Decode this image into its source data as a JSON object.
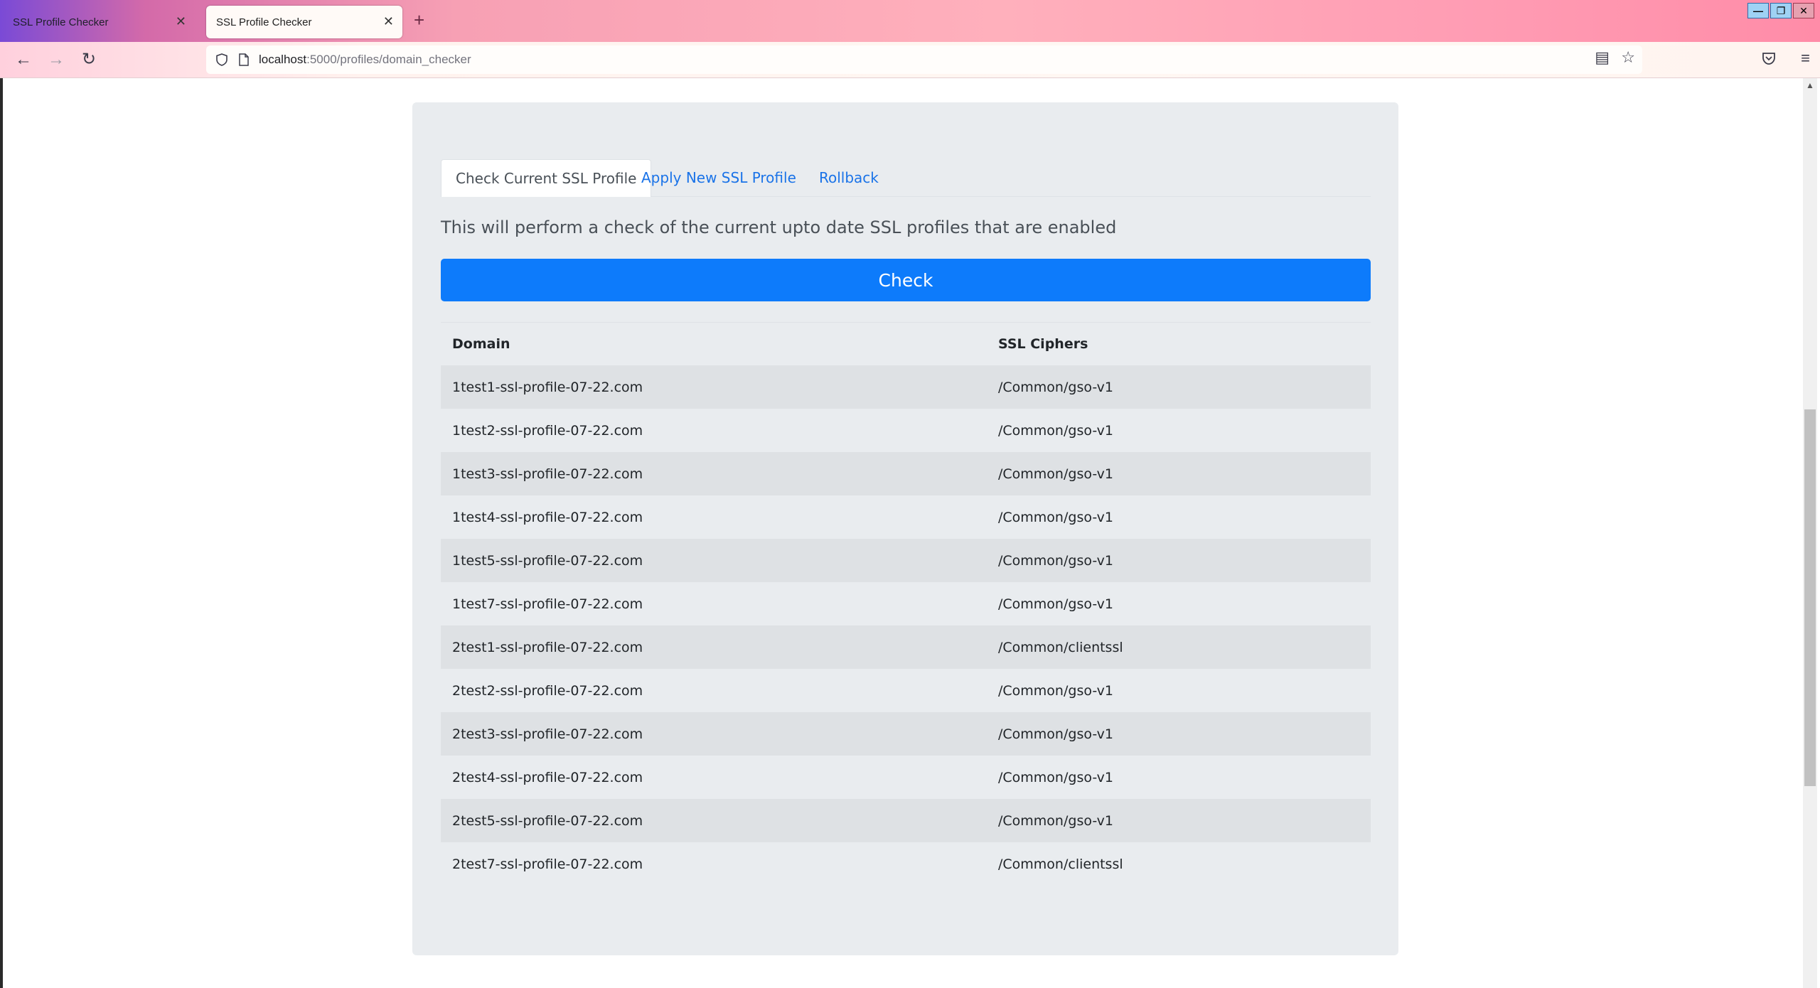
{
  "browser": {
    "tabs": [
      {
        "title": "SSL Profile Checker",
        "active": false
      },
      {
        "title": "SSL Profile Checker",
        "active": true
      }
    ],
    "url_host": "localhost",
    "url_rest": ":5000/profiles/domain_checker"
  },
  "page": {
    "tabs": [
      "Check Current SSL Profile",
      "Apply New SSL Profile",
      "Rollback"
    ],
    "active_tab": "Check Current SSL Profile",
    "description": "This will perform a check of the current upto date SSL profiles that are enabled",
    "check_button": "Check",
    "table": {
      "headers": [
        "Domain",
        "SSL Ciphers"
      ],
      "rows": [
        [
          "1test1-ssl-profile-07-22.com",
          "/Common/gso-v1"
        ],
        [
          "1test2-ssl-profile-07-22.com",
          "/Common/gso-v1"
        ],
        [
          "1test3-ssl-profile-07-22.com",
          "/Common/gso-v1"
        ],
        [
          "1test4-ssl-profile-07-22.com",
          "/Common/gso-v1"
        ],
        [
          "1test5-ssl-profile-07-22.com",
          "/Common/gso-v1"
        ],
        [
          "1test7-ssl-profile-07-22.com",
          "/Common/gso-v1"
        ],
        [
          "2test1-ssl-profile-07-22.com",
          "/Common/clientssl"
        ],
        [
          "2test2-ssl-profile-07-22.com",
          "/Common/gso-v1"
        ],
        [
          "2test3-ssl-profile-07-22.com",
          "/Common/gso-v1"
        ],
        [
          "2test4-ssl-profile-07-22.com",
          "/Common/gso-v1"
        ],
        [
          "2test5-ssl-profile-07-22.com",
          "/Common/gso-v1"
        ],
        [
          "2test7-ssl-profile-07-22.com",
          "/Common/clientssl"
        ]
      ]
    }
  },
  "colors": {
    "primary": "#0d7bfb",
    "link": "#1a73e8",
    "card_bg": "#e9ecef",
    "stripe": "#dee1e4"
  }
}
